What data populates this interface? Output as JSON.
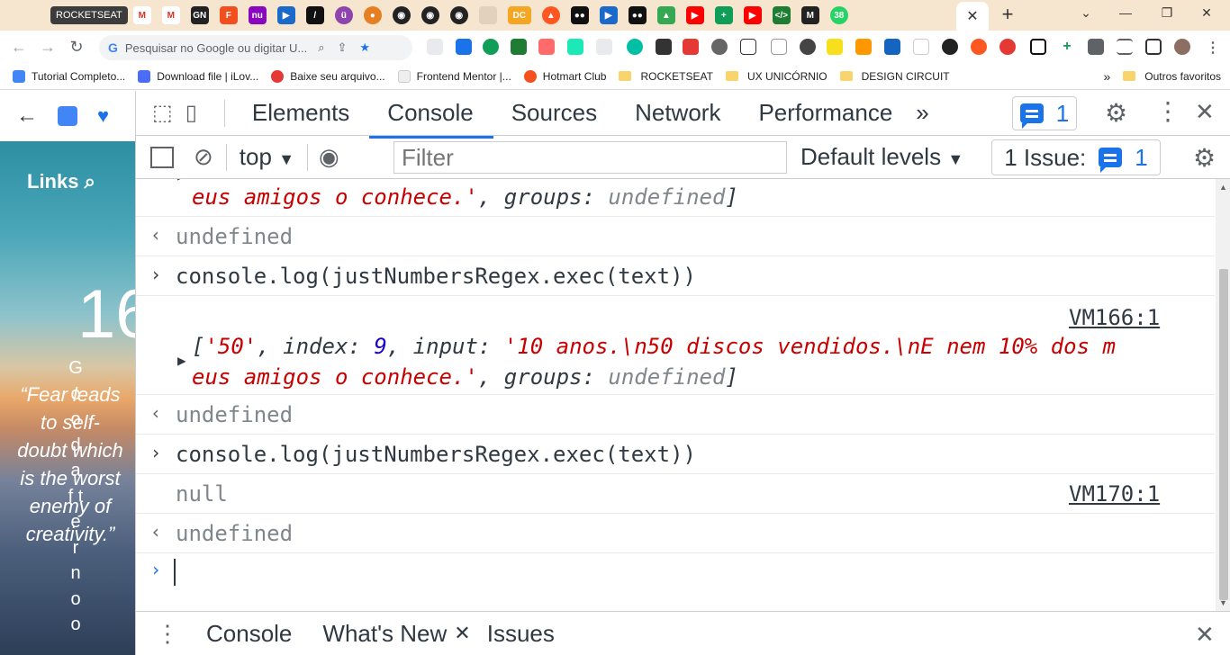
{
  "browser": {
    "tab_rocketseat_label": "ROCKETSEAT",
    "new_tab_label": "+",
    "active_tab_close": "✕",
    "omnibox_placeholder": "Pesquisar no Google ou digitar U...",
    "extension_badge": "38",
    "dc_badge": "DC",
    "bookmarks": [
      {
        "label": "Tutorial Completo...",
        "color": "#4285f4"
      },
      {
        "label": "Download file | iLov...",
        "color": "#4a6cf7"
      },
      {
        "label": "Baixe seu arquivo...",
        "color": "#e53935"
      },
      {
        "label": "Frontend Mentor |...",
        "color": "#ccc"
      },
      {
        "label": "Hotmart Club",
        "color": "#f4511e"
      }
    ],
    "bookmark_folders": [
      "ROCKETSEAT",
      "UX UNICÓRNIO",
      "DESIGN CIRCUIT"
    ],
    "more_bookmarks": "»",
    "other_favorites": "Outros favoritos"
  },
  "page": {
    "links_title": "Links",
    "big_number": "16",
    "quote": "“Fear leads to self-doubt which is the worst enemy of creativity.”",
    "vertical_text": "G o o d a f t e r n o o"
  },
  "devtools": {
    "tabs": [
      "Elements",
      "Console",
      "Sources",
      "Network",
      "Performance"
    ],
    "more_tabs": "»",
    "issues_count": "1",
    "context": "top",
    "filter_placeholder": "Filter",
    "levels": "Default levels",
    "issues_label": "1 Issue:",
    "issues_count2": "1",
    "console": {
      "row1_line2_str": "eus amigos o conhece.'",
      "row1_line2_key": "groups",
      "row1_line2_val": "undefined",
      "undefined_1": "undefined",
      "cmd_1": "console.log(justNumbersRegex.exec(text))",
      "vm_1": "VM166:1",
      "arr_open": "[",
      "arr_match": "'50'",
      "arr_index_key": "index",
      "arr_index_val": "9",
      "arr_input_key": "input",
      "arr_input_val": "'10 anos.\\n50 discos vendidos.\\nE nem 10% dos m",
      "arr_line2_str": "eus amigos o conhece.'",
      "arr_groups_key": "groups",
      "arr_groups_val": "undefined",
      "arr_close": "]",
      "undefined_2": "undefined",
      "cmd_2": "console.log(justNumbersRegex.exec(text))",
      "null_out": "null",
      "vm_2": "VM170:1",
      "undefined_3": "undefined"
    },
    "drawer_tabs": [
      "Console",
      "What's New",
      "Issues"
    ]
  }
}
